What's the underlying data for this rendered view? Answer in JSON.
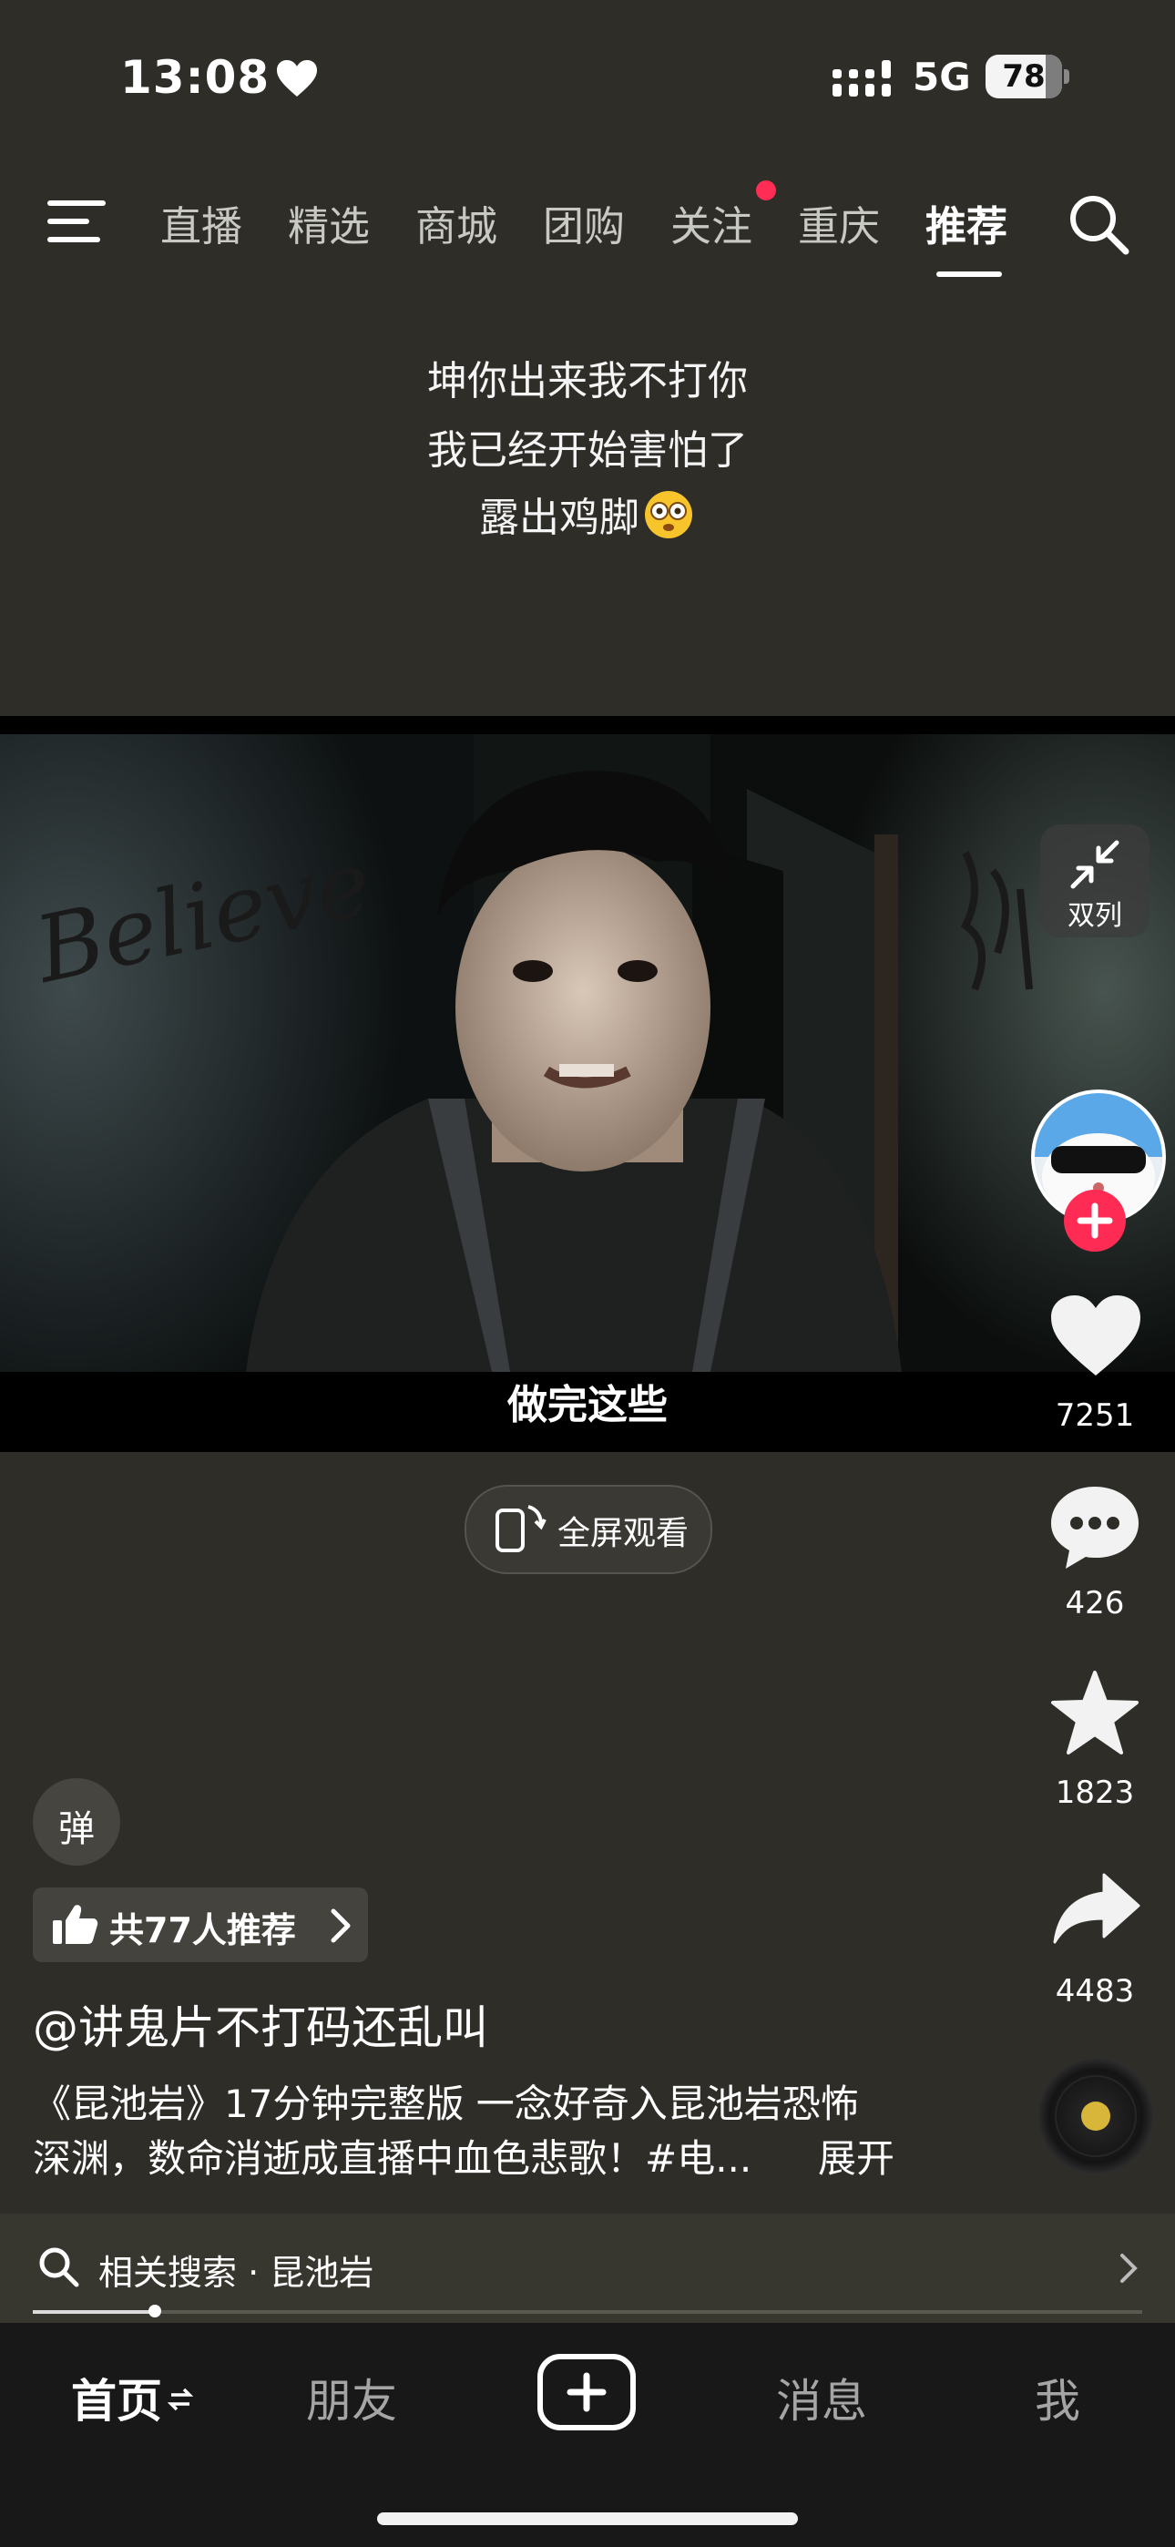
{
  "status_bar": {
    "time": "13:08",
    "network": "5G",
    "battery": "78",
    "battery_level": 0.78
  },
  "top_tabs": {
    "items": [
      {
        "label": "直播"
      },
      {
        "label": "精选"
      },
      {
        "label": "商城"
      },
      {
        "label": "团购"
      },
      {
        "label": "关注"
      },
      {
        "label": "重庆"
      },
      {
        "label": "推荐"
      }
    ],
    "active": "推荐"
  },
  "caption": {
    "lines": [
      "坤你出来我不打你",
      "我已经开始害怕了",
      "露出鸡脚"
    ]
  },
  "video": {
    "subtitle": "做完这些",
    "graffiti": "Believe"
  },
  "dual_column": {
    "label": "双列"
  },
  "actions": {
    "likes": "7251",
    "comments": "426",
    "favorites": "1823",
    "shares": "4483"
  },
  "fullscreen": {
    "label": "全屏观看"
  },
  "danmu": {
    "label": "弹"
  },
  "recommend": {
    "label": "共77人推荐"
  },
  "post": {
    "author": "@讲鬼片不打码还乱叫",
    "description_line1": "《昆池岩》17分钟完整版 一念好奇入昆池岩恐怖",
    "description_line2": "深渊，数命消逝成直播中血色悲歌！#电...",
    "expand_label": "展开"
  },
  "related_search": {
    "label": "相关搜索 · 昆池岩"
  },
  "playback": {
    "progress": 0.11
  },
  "bottom_nav": {
    "home": "首页",
    "friends": "朋友",
    "messages": "消息",
    "me": "我"
  },
  "colors": {
    "accent": "#fe2c55",
    "background": "#2e2d28"
  }
}
